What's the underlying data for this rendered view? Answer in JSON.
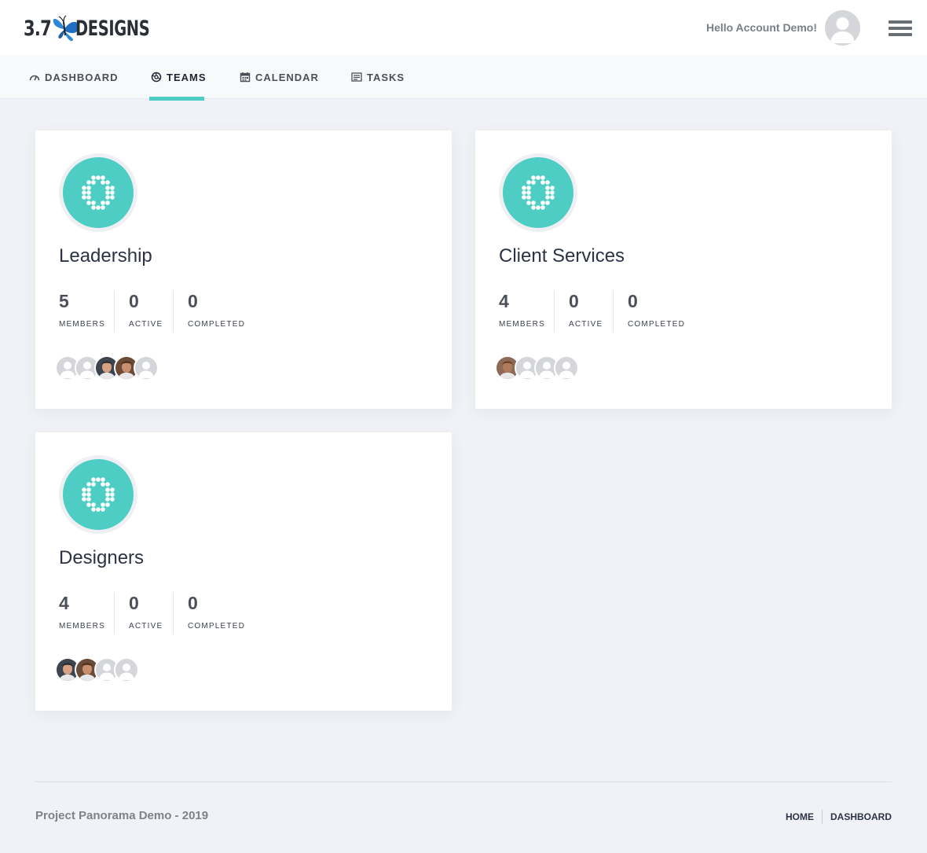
{
  "header": {
    "logo_left": "3.7",
    "logo_right": "DESIGNS",
    "greeting": "Hello Account Demo!"
  },
  "nav": {
    "items": [
      {
        "label": "DASHBOARD",
        "icon": "dashboard-gauge-icon"
      },
      {
        "label": "TEAMS",
        "icon": "teams-icon",
        "active": true
      },
      {
        "label": "CALENDAR",
        "icon": "calendar-icon"
      },
      {
        "label": "TASKS",
        "icon": "tasks-list-icon"
      }
    ],
    "active_color": "#4ecdc4"
  },
  "teams": [
    {
      "name": "Leadership",
      "members": "5",
      "active": "0",
      "completed": "0",
      "avatars": [
        "placeholder",
        "placeholder",
        "photo",
        "photo",
        "placeholder"
      ]
    },
    {
      "name": "Client Services",
      "members": "4",
      "active": "0",
      "completed": "0",
      "avatars": [
        "photo",
        "placeholder",
        "placeholder",
        "placeholder"
      ]
    },
    {
      "name": "Designers",
      "members": "4",
      "active": "0",
      "completed": "0",
      "avatars": [
        "photo",
        "photo",
        "placeholder",
        "placeholder"
      ]
    }
  ],
  "stat_labels": {
    "members": "MEMBERS",
    "active": "ACTIVE",
    "completed": "COMPLETED"
  },
  "footer": {
    "text": "Project Panorama Demo - 2019",
    "links": [
      "HOME",
      "DASHBOARD"
    ]
  },
  "colors": {
    "accent": "#4ecdc4",
    "background": "#f0f2f7"
  }
}
